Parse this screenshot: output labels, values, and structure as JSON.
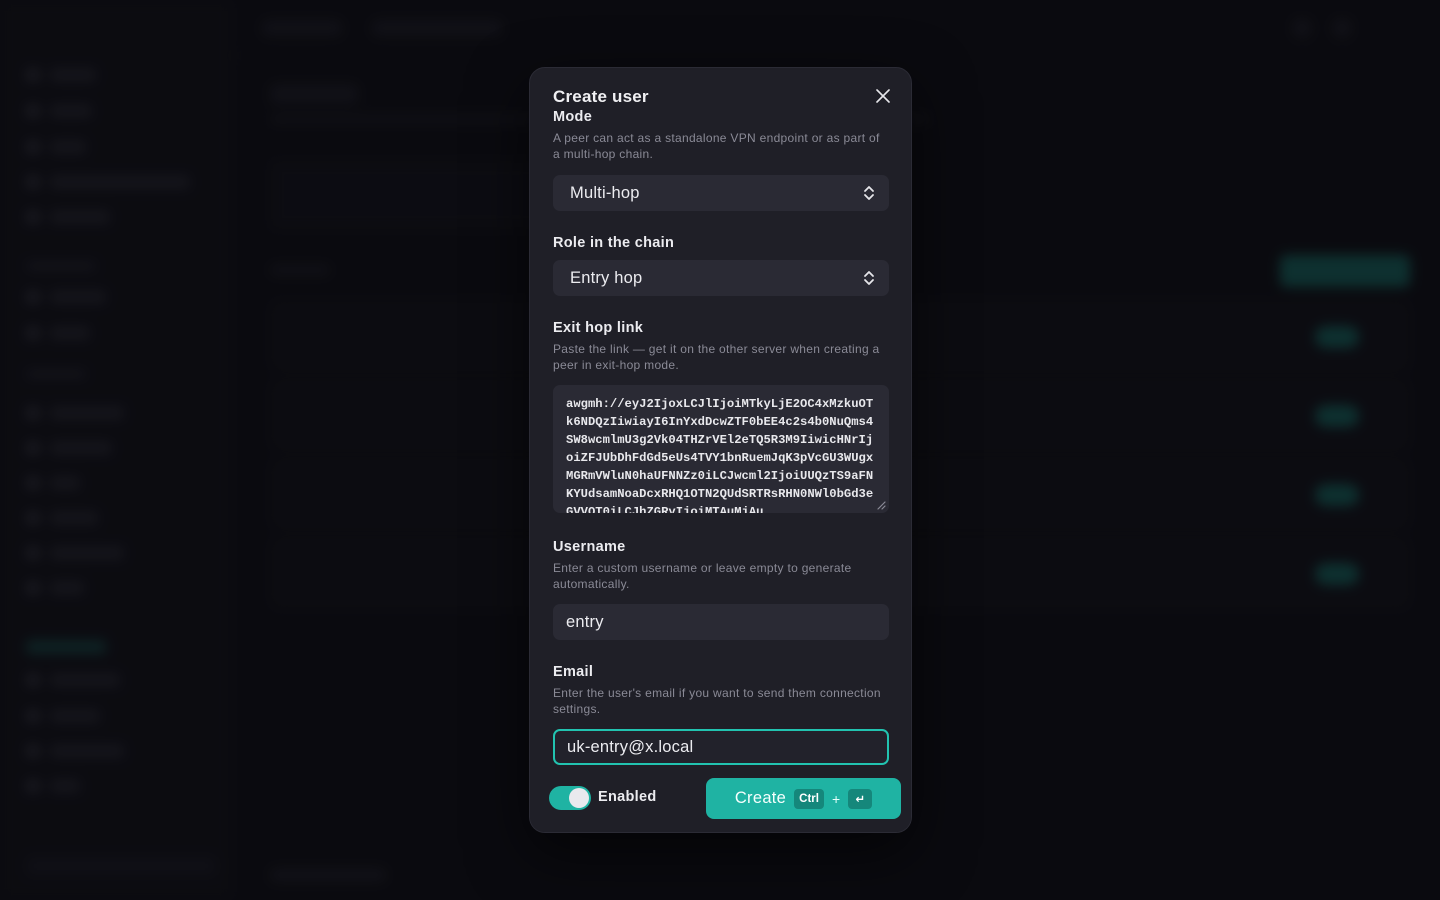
{
  "modal": {
    "title": "Create user",
    "mode": {
      "label": "Mode",
      "help": "A peer can act as a standalone VPN endpoint or as part of a multi-hop chain.",
      "value": "Multi-hop"
    },
    "role": {
      "label": "Role in the chain",
      "value": "Entry hop"
    },
    "exit_link": {
      "label": "Exit hop link",
      "help": "Paste the link — get it on the other server when creating a peer in exit-hop mode.",
      "value": "awgmh://eyJ2IjoxLCJlIjoiMTkyLjE2OC4xMzkuOTk6NDQzIiwiayI6InYxdDcwZTF0bEE4c2s4b0NuQms4SW8wcmlmU3g2Vk04THZrVEl2eTQ5R3M9IiwicHNrIjoiZFJUbDhFdGd5eUs4TVY1bnRuemJqK3pVcGU3WUgxMGRmVWluN0haUFNNZz0iLCJwcml2IjoiUUQzTS9aFNKYUdsamNoaDcxRHQ1OTN2QUdSRTRsRHN0NWl0bGd3eGVVOT0iLCJhZGRyIjoiMTAuMjAu"
    },
    "username": {
      "label": "Username",
      "help": "Enter a custom username or leave empty to generate automatically.",
      "value": "entry"
    },
    "email": {
      "label": "Email",
      "help": "Enter the user's email if you want to send them connection settings.",
      "value": "uk-entry@x.local"
    },
    "enabled": {
      "label": "Enabled",
      "on": true
    },
    "create": {
      "label": "Create",
      "kbd_mod": "Ctrl",
      "kbd_plus": "+",
      "kbd_key": "↵"
    }
  },
  "colors": {
    "accent": "#1fb3a3",
    "modal_bg": "#1f1f27",
    "field_bg": "#2a2a34"
  },
  "icons": {
    "close": "close-icon",
    "select_chevron": "chevron-updown-icon",
    "resize": "resize-grip-icon",
    "enter": "enter-key-icon"
  }
}
